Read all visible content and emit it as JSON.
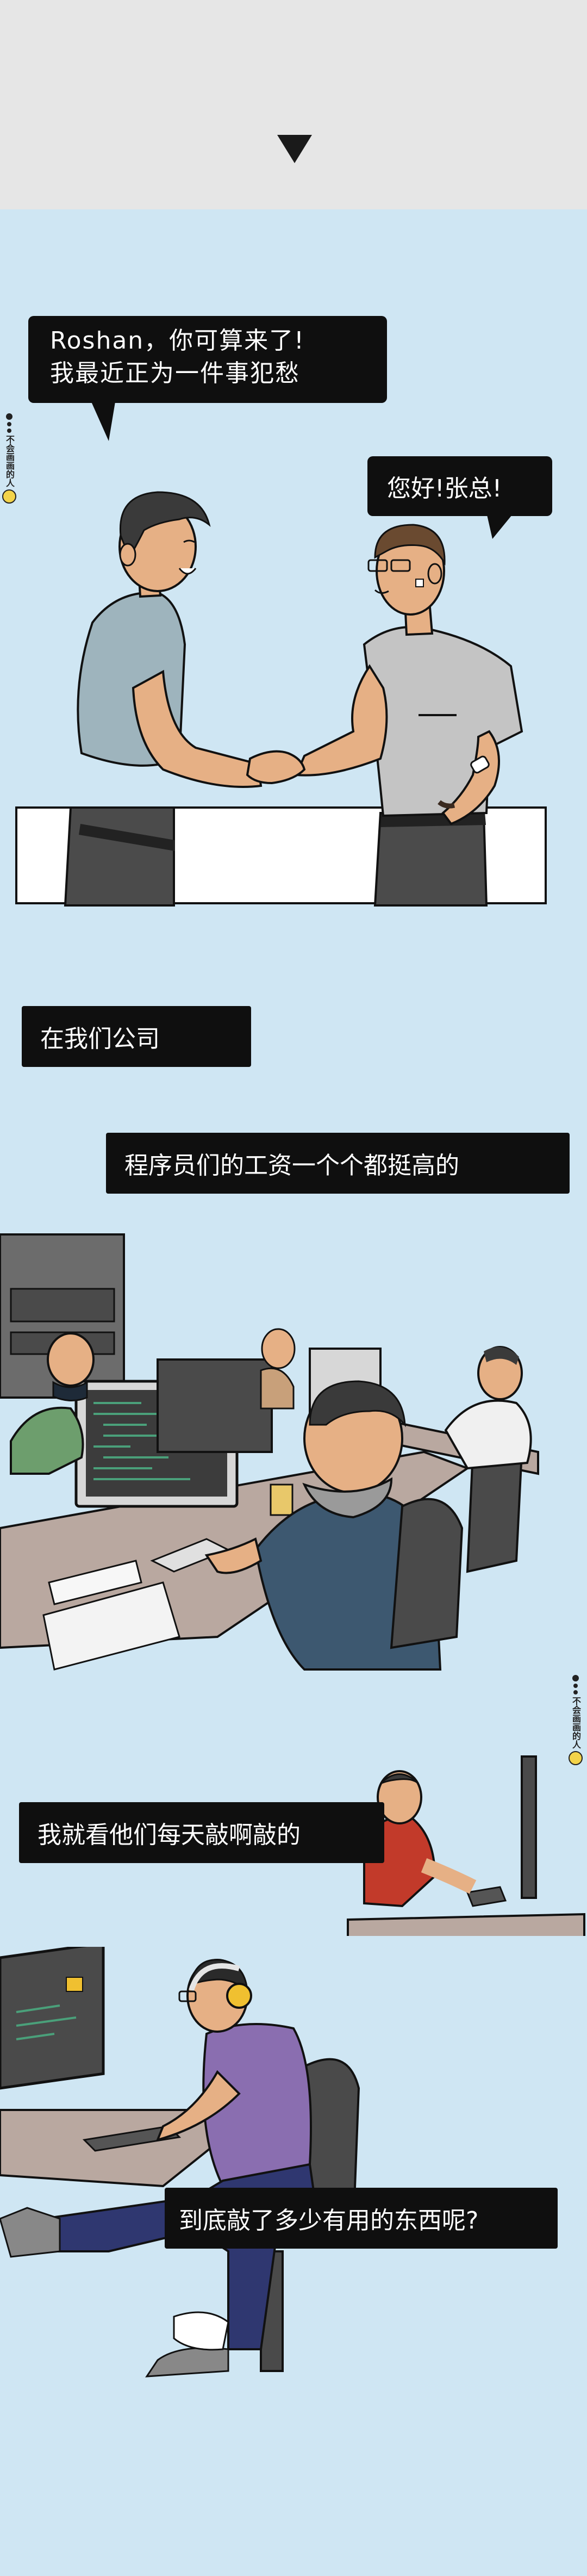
{
  "scene1": {
    "bubble_client_line1": "Roshan，你可算来了!",
    "bubble_client_line2": "我最近正为一件事犯愁",
    "bubble_roshan": "您好!张总!"
  },
  "scene2": {
    "caption_1": "在我们公司",
    "caption_2": "程序员们的工资一个个都挺高的"
  },
  "scene3": {
    "caption_3": "我就看他们每天敲啊敲的",
    "caption_4": "到底敲了多少有用的东西呢?"
  },
  "watermark": {
    "text": "不会画画的人"
  },
  "colors": {
    "background": "#cfe6f3",
    "top_band": "#e6e6e6",
    "caption_bg": "#0f0f0f",
    "caption_text": "#ffffff"
  }
}
